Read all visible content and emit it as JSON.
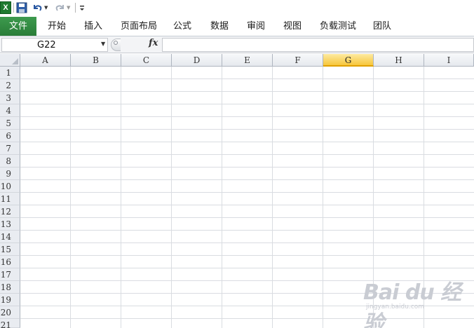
{
  "qat": {
    "icons": [
      "excel-icon",
      "save-icon",
      "undo-icon",
      "redo-icon",
      "customize-qat-icon"
    ],
    "excel_glyph": "X"
  },
  "ribbon": {
    "file_label": "文件",
    "tabs": [
      "开始",
      "插入",
      "页面布局",
      "公式",
      "数据",
      "审阅",
      "视图",
      "负载测试",
      "团队"
    ]
  },
  "formula_bar": {
    "name_box": "G22",
    "fx_label": "fx",
    "formula": ""
  },
  "grid": {
    "columns": [
      "A",
      "B",
      "C",
      "D",
      "E",
      "F",
      "G",
      "H",
      "I"
    ],
    "selected_column": "G",
    "rows": [
      "1",
      "2",
      "3",
      "4",
      "5",
      "6",
      "7",
      "8",
      "9",
      "10",
      "11",
      "12",
      "13",
      "14",
      "15",
      "16",
      "17",
      "18",
      "19",
      "20",
      "21"
    ]
  },
  "watermark": {
    "main": "Bai du 经验",
    "sub": "jingyan.baidu.com"
  },
  "colors": {
    "file_tab": "#2a7d38",
    "selected_header": "#f7c73c",
    "gridline": "#d9dce1"
  }
}
